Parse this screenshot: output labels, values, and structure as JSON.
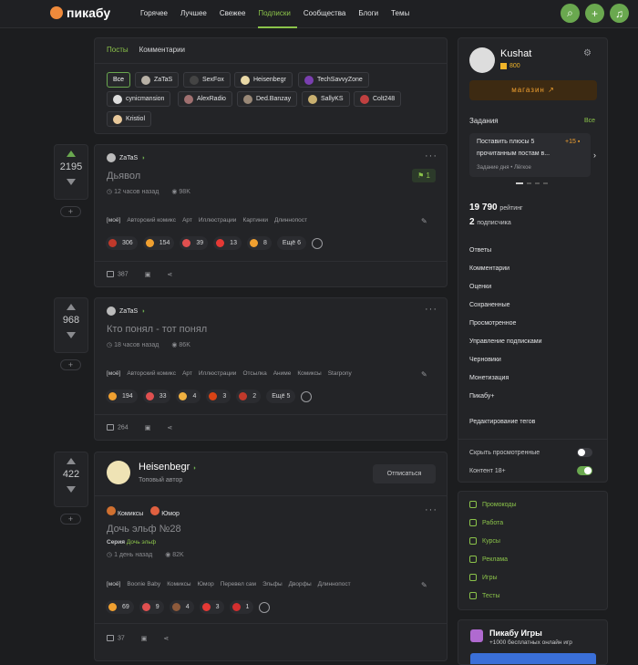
{
  "header": {
    "logo": "пикабу",
    "nav": [
      "Горячее",
      "Лучшее",
      "Свежее",
      "Подписки",
      "Сообщества",
      "Блоги",
      "Темы"
    ],
    "active": "Подписки"
  },
  "filters": {
    "tabs": [
      "Посты",
      "Комментарии"
    ],
    "chips_row1": [
      "Все",
      "ZaTaS",
      "SexFox",
      "Heisenbegr",
      "TechSavvyZone"
    ],
    "chips_row2": [
      "cynicmansion",
      "AlexRadio",
      "Ded.Banzay",
      "SallyKS",
      "Colt248"
    ],
    "chips_row3": [
      "Kristiol"
    ]
  },
  "posts": [
    {
      "rating": "2195",
      "author": "ZaTaS",
      "title": "Дьявол",
      "time": "12 часов назад",
      "views": "98K",
      "pin": "1",
      "tags": [
        "[моё]",
        "Авторский комикс",
        "Арт",
        "Иллюстрации",
        "Картинки",
        "Длиннопост"
      ],
      "reactions": [
        {
          "n": "306",
          "c": "#c0392b"
        },
        {
          "n": "154",
          "c": "#f0a030"
        },
        {
          "n": "39",
          "c": "#e05050"
        },
        {
          "n": "13",
          "c": "#e53935"
        },
        {
          "n": "8",
          "c": "#f0a030"
        }
      ],
      "more": "Ещё 6",
      "comments": "387"
    },
    {
      "rating": "968",
      "author": "ZaTaS",
      "title": "Кто понял - тот понял",
      "time": "18 часов назад",
      "views": "86K",
      "tags": [
        "[моё]",
        "Авторский комикс",
        "Арт",
        "Иллюстрации",
        "Отсылка",
        "Аниме",
        "Комиксы",
        "Starpony"
      ],
      "reactions": [
        {
          "n": "194",
          "c": "#f0a030"
        },
        {
          "n": "33",
          "c": "#e05050"
        },
        {
          "n": "4",
          "c": "#f0b040"
        },
        {
          "n": "3",
          "c": "#d84315"
        },
        {
          "n": "2",
          "c": "#c0392b"
        }
      ],
      "more": "Ещё 5",
      "comments": "264"
    },
    {
      "rating": "422",
      "author": "Heisenbegr",
      "subtitle": "Топовый автор",
      "follow": "Отписаться",
      "communities": [
        "Комиксы",
        "Юмор"
      ],
      "title": "Дочь эльф №28",
      "series_label": "Серия",
      "series": "Дочь эльф",
      "time": "1 день назад",
      "views": "82K",
      "tags": [
        "[моё]",
        "Boonie Baby",
        "Комиксы",
        "Юмор",
        "Перевел сам",
        "Эльфы",
        "Дворфы",
        "Длиннопост"
      ],
      "reactions": [
        {
          "n": "69",
          "c": "#f0a030"
        },
        {
          "n": "9",
          "c": "#e05050"
        },
        {
          "n": "4",
          "c": "#8d5a3b"
        },
        {
          "n": "3",
          "c": "#e53935"
        },
        {
          "n": "1",
          "c": "#d32f2f"
        }
      ],
      "comments": "37"
    }
  ],
  "profile": {
    "name": "Kushat",
    "coins": "800",
    "shop": "магазин",
    "tasks_label": "Задания",
    "tasks_all": "Все",
    "task_text1": "Поставить плюсы 5",
    "task_text2": "прочитанным постам в...",
    "task_reward": "+15",
    "task_meta": "Задание дня",
    "task_level": "Лёгкое",
    "rating_val": "19 790",
    "rating_label": "рейтинг",
    "subs_val": "2",
    "subs_label": "подписчика"
  },
  "side_menu": [
    "Ответы",
    "Комментарии",
    "Оценки",
    "Сохраненные",
    "Просмотренное",
    "Управление подписками",
    "Черновики",
    "Монетизация",
    "Пикабу+"
  ],
  "edit_tags": "Редактирование тегов",
  "toggles": [
    {
      "label": "Скрыть просмотренные",
      "on": false
    },
    {
      "label": "Контент 18+",
      "on": true
    }
  ],
  "links": [
    "Промокоды",
    "Работа",
    "Курсы",
    "Реклама",
    "Игры",
    "Тесты"
  ],
  "games": {
    "title": "Пикабу Игры",
    "subtitle": "+1000 бесплатных онлайн игр"
  },
  "colors": {
    "accent": "#8bc34a",
    "bg": "#1c1d1f",
    "card": "#232427"
  }
}
